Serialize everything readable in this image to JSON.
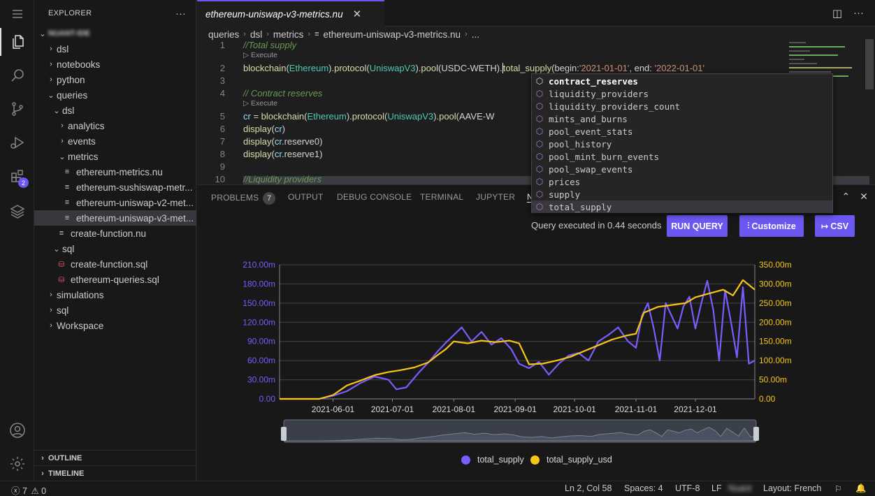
{
  "explorer": {
    "title": "EXPLORER",
    "more": "···",
    "project": "NUANT-IDE",
    "items": [
      {
        "label": "dsl",
        "type": "folder",
        "open": false,
        "depth": 0
      },
      {
        "label": "notebooks",
        "type": "folder",
        "open": false,
        "depth": 0
      },
      {
        "label": "python",
        "type": "folder",
        "open": false,
        "depth": 0
      },
      {
        "label": "queries",
        "type": "folder",
        "open": true,
        "depth": 0
      },
      {
        "label": "dsl",
        "type": "folder",
        "open": true,
        "depth": 1
      },
      {
        "label": "analytics",
        "type": "folder",
        "open": false,
        "depth": 2
      },
      {
        "label": "events",
        "type": "folder",
        "open": false,
        "depth": 2
      },
      {
        "label": "metrics",
        "type": "folder",
        "open": true,
        "depth": 2
      },
      {
        "label": "ethereum-metrics.nu",
        "type": "file",
        "depth": 3
      },
      {
        "label": "ethereum-sushiswap-metr...",
        "type": "file",
        "depth": 3
      },
      {
        "label": "ethereum-uniswap-v2-met...",
        "type": "file",
        "depth": 3
      },
      {
        "label": "ethereum-uniswap-v3-met...",
        "type": "file",
        "depth": 3,
        "selected": true
      },
      {
        "label": "create-function.nu",
        "type": "file",
        "depth": 2
      },
      {
        "label": "sql",
        "type": "folder",
        "open": true,
        "depth": 1
      },
      {
        "label": "create-function.sql",
        "type": "db",
        "depth": 2
      },
      {
        "label": "ethereum-queries.sql",
        "type": "db",
        "depth": 2
      },
      {
        "label": "simulations",
        "type": "folder",
        "open": false,
        "depth": 0
      },
      {
        "label": "sql",
        "type": "folder",
        "open": false,
        "depth": 0
      },
      {
        "label": "Workspace",
        "type": "folder",
        "open": false,
        "depth": 0
      }
    ],
    "outline": "OUTLINE",
    "timeline": "TIMELINE"
  },
  "activity": {
    "extensions_badge": "2"
  },
  "tab": {
    "title": "ethereum-uniswap-v3-metrics.nu",
    "close": "✕"
  },
  "breadcrumb": [
    "queries",
    "dsl",
    "metrics",
    "ethereum-uniswap-v3-metrics.nu",
    "..."
  ],
  "code": {
    "line_numbers": [
      "1",
      "2",
      "3",
      "4",
      "5",
      "6",
      "7",
      "8",
      "9",
      "10"
    ],
    "execute_label": "▷ Execute",
    "comment1": "//Total supply",
    "comment2": "// Contract reserves",
    "comment3": "//Liquidity providers",
    "line2": {
      "a": "blockchain",
      "b": "Ethereum",
      "c": "protocol",
      "d": "UniswapV3",
      "e": "pool",
      "f": "USDC-WETH",
      "g": "total_supply",
      "h": "begin:",
      "i": "'2021-01-01'",
      "j": ", end: ",
      "k": "'2022-01-01'"
    },
    "line5": {
      "var": "cr",
      "a": "blockchain",
      "b": "Ethereum",
      "c": "protocol",
      "d": "UniswapV3",
      "e": "pool",
      "f": "AAVE-W"
    },
    "line6": {
      "fn": "display",
      "arg": "cr"
    },
    "line7": {
      "fn": "display",
      "arg": "cr",
      "prop": "reserve0"
    },
    "line8": {
      "fn": "display",
      "arg": "cr",
      "prop": "reserve1"
    }
  },
  "suggest": [
    "contract_reserves",
    "liquidity_providers",
    "liquidity_providers_count",
    "mints_and_burns",
    "pool_event_stats",
    "pool_history",
    "pool_mint_burn_events",
    "pool_swap_events",
    "prices",
    "supply",
    "total_supply"
  ],
  "panel": {
    "tabs": [
      "PROBLEMS",
      "OUTPUT",
      "DEBUG CONSOLE",
      "TERMINAL",
      "JUPYTER",
      "N"
    ],
    "problems_count": "7",
    "status": "Query executed in 0.44 seconds",
    "run_query": "RUN QUERY",
    "customize": "Customize",
    "csv": "CSV"
  },
  "chart_data": {
    "type": "line",
    "y_left": {
      "ticks": [
        "0.00",
        "30.00m",
        "60.00m",
        "90.00m",
        "120.00m",
        "150.00m",
        "180.00m",
        "210.00m"
      ],
      "range": [
        0,
        210
      ],
      "color": "#7b5cff"
    },
    "y_right": {
      "ticks": [
        "0.00",
        "50.00m",
        "100.00m",
        "150.00m",
        "200.00m",
        "250.00m",
        "300.00m",
        "350.00m"
      ],
      "range": [
        0,
        350
      ],
      "color": "#f5c518"
    },
    "x_ticks": [
      "2021-06-01",
      "2021-07-01",
      "2021-08-01",
      "2021-09-01",
      "2021-10-01",
      "2021-11-01",
      "2021-12-01"
    ],
    "x_range": [
      "2021-05-05",
      "2021-12-31"
    ],
    "series": [
      {
        "name": "total_supply",
        "axis": "left",
        "color": "#7b5cff",
        "x": [
          "2021-05-05",
          "2021-05-15",
          "2021-05-25",
          "2021-06-01",
          "2021-06-08",
          "2021-06-15",
          "2021-06-22",
          "2021-06-29",
          "2021-07-03",
          "2021-07-08",
          "2021-07-14",
          "2021-07-20",
          "2021-07-24",
          "2021-07-28",
          "2021-08-01",
          "2021-08-05",
          "2021-08-10",
          "2021-08-15",
          "2021-08-20",
          "2021-08-25",
          "2021-08-30",
          "2021-09-03",
          "2021-09-08",
          "2021-09-13",
          "2021-09-18",
          "2021-09-23",
          "2021-09-28",
          "2021-10-03",
          "2021-10-08",
          "2021-10-13",
          "2021-10-18",
          "2021-10-23",
          "2021-10-28",
          "2021-11-01",
          "2021-11-04",
          "2021-11-07",
          "2021-11-10",
          "2021-11-13",
          "2021-11-16",
          "2021-11-19",
          "2021-11-22",
          "2021-11-25",
          "2021-11-28",
          "2021-12-01",
          "2021-12-04",
          "2021-12-07",
          "2021-12-10",
          "2021-12-13",
          "2021-12-16",
          "2021-12-19",
          "2021-12-22",
          "2021-12-25",
          "2021-12-28",
          "2021-12-31"
        ],
        "values": [
          0,
          0,
          0,
          5,
          12,
          25,
          35,
          30,
          15,
          18,
          40,
          60,
          75,
          88,
          100,
          112,
          90,
          105,
          85,
          95,
          78,
          55,
          48,
          58,
          38,
          55,
          68,
          72,
          60,
          90,
          100,
          112,
          90,
          80,
          130,
          150,
          110,
          60,
          150,
          130,
          110,
          145,
          160,
          110,
          150,
          185,
          140,
          60,
          170,
          120,
          65,
          175,
          55,
          60
        ]
      },
      {
        "name": "total_supply_usd",
        "axis": "right",
        "color": "#f5c518",
        "x": [
          "2021-05-05",
          "2021-05-15",
          "2021-05-25",
          "2021-06-01",
          "2021-06-08",
          "2021-06-15",
          "2021-06-22",
          "2021-06-29",
          "2021-07-05",
          "2021-07-12",
          "2021-07-19",
          "2021-07-24",
          "2021-07-28",
          "2021-08-01",
          "2021-08-08",
          "2021-08-15",
          "2021-08-22",
          "2021-08-29",
          "2021-09-03",
          "2021-09-08",
          "2021-09-15",
          "2021-09-22",
          "2021-09-29",
          "2021-10-06",
          "2021-10-13",
          "2021-10-20",
          "2021-10-27",
          "2021-11-01",
          "2021-11-05",
          "2021-11-12",
          "2021-11-19",
          "2021-11-26",
          "2021-12-01",
          "2021-12-08",
          "2021-12-15",
          "2021-12-20",
          "2021-12-25",
          "2021-12-31"
        ],
        "values": [
          0,
          0,
          0,
          10,
          35,
          48,
          62,
          70,
          75,
          82,
          95,
          115,
          130,
          150,
          145,
          152,
          148,
          152,
          145,
          90,
          92,
          100,
          110,
          125,
          140,
          155,
          165,
          170,
          225,
          240,
          245,
          250,
          265,
          275,
          285,
          270,
          310,
          285
        ]
      }
    ]
  }
}
